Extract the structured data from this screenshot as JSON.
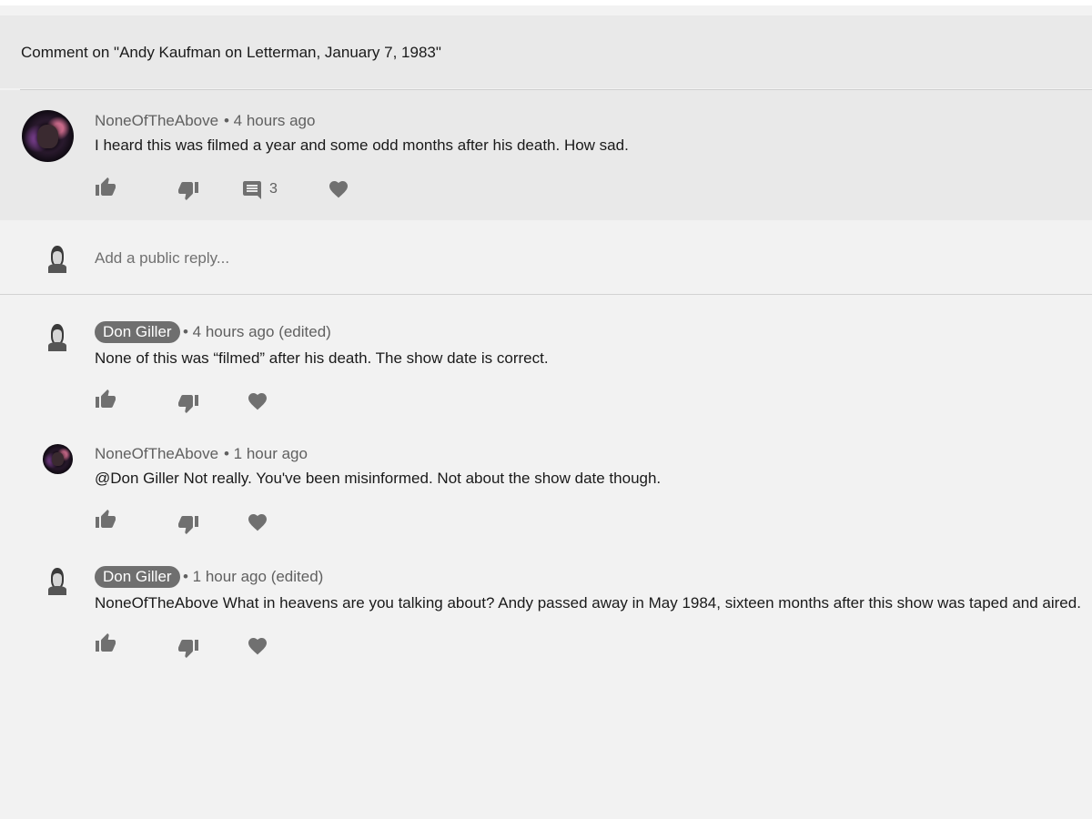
{
  "header": {
    "title": "Comment on \"Andy Kaufman on Letterman, January 7, 1983\""
  },
  "main_comment": {
    "author": "NoneOfTheAbove",
    "meta": "• 4 hours ago",
    "text": "I heard this was filmed a year and some odd months after his death. How sad.",
    "reply_count": "3"
  },
  "reply_box": {
    "placeholder": "Add a public reply..."
  },
  "replies": [
    {
      "author": "Don Giller",
      "meta": "• 4 hours ago (edited)",
      "text": "None of this was “filmed” after his death. The show date is correct."
    },
    {
      "author": "NoneOfTheAbove",
      "meta": "• 1 hour ago",
      "text": "@Don Giller Not really. You've been misinformed. Not about the show date though."
    },
    {
      "author": "Don Giller",
      "meta": "• 1 hour ago (edited)",
      "text": "NoneOfTheAbove What in heavens are you talking about? Andy passed away in May 1984, sixteen months after this show was taped and aired."
    }
  ],
  "icons": {
    "like": "thumb-up-icon",
    "dislike": "thumb-down-icon",
    "reply": "comment-icon",
    "heart": "heart-icon"
  },
  "colors": {
    "icon": "#707070",
    "badge": "#6f6f6f",
    "background": "#f2f2f2",
    "highlight": "#e9e9e9"
  }
}
